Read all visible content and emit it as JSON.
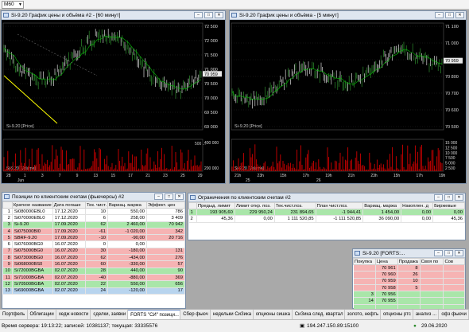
{
  "toolbar": {
    "timeframe": "M60"
  },
  "chart_windows": [
    {
      "title": "Si-9.20 График цены и объёма #2 - [60 минут]",
      "price_ticks": [
        "72 500",
        "72 000",
        "71 500",
        "71 000",
        "70 500",
        "70 000",
        "69 500",
        "69 000"
      ],
      "price_label": "Si-9.20 [Price]",
      "last_price": "70 959",
      "volume_label": "Si-9.20 [Volume]",
      "volume_ticks": [
        "400 000",
        "200 000"
      ],
      "volume_tag": "500 ...",
      "dates": [
        "28",
        "1",
        "3",
        "7",
        "9",
        "13",
        "15",
        "17",
        "21",
        "23",
        "25",
        "29"
      ],
      "month_labels": [
        "Jun"
      ]
    },
    {
      "title": "Si-9.20 График цены и объёма - [5 минут]",
      "price_ticks": [
        "71 100",
        "71 000",
        "70 900",
        "70 800",
        "70 700",
        "70 600",
        "70 500"
      ],
      "price_label": "Si-9.20 [Price]",
      "last_price": "70 959",
      "volume_label": "Si-9.20 [Volume]",
      "volume_ticks": [
        "15 000",
        "12 500",
        "10 000",
        "7 500",
        "5 000",
        "2 500"
      ],
      "dates": [
        "21h",
        "23h",
        "15h",
        "17h",
        "19h",
        "21h",
        "23h",
        "15h",
        "17h",
        "19h"
      ],
      "month_labels": [
        "25",
        "26"
      ]
    }
  ],
  "positions": {
    "title": "Позиции по клиентским счетам (фьючерсы) #2",
    "columns": [
      "",
      "Краткое название",
      "Дата погаше",
      "Тек. чист.",
      "Вариац. маржа",
      "Эффект. цен"
    ],
    "rows": [
      {
        "n": "1",
        "name": "Si080000EBL0",
        "date": "17.12.2020",
        "qty": "10",
        "var": "550,00",
        "eff": "786",
        "style": "white"
      },
      {
        "n": "2",
        "name": "Si070000EBL0",
        "date": "17.12.2020",
        "qty": "6",
        "var": "258,00",
        "eff": "3 409",
        "style": "white"
      },
      {
        "n": "3",
        "name": "Si-9.20",
        "date": "17.09.2020",
        "qty": "62",
        "var": "2 460,00",
        "eff": "70 942",
        "style": "green"
      },
      {
        "n": "4",
        "name": "Si075000BI0",
        "date": "17.09.2020",
        "qty": "-61",
        "var": "-1 020,00",
        "eff": "342",
        "style": "red"
      },
      {
        "n": "5",
        "name": "SBRF-9.20",
        "date": "17.09.2020",
        "qty": "-10",
        "var": "-90,00",
        "eff": "20 716",
        "style": "red"
      },
      {
        "n": "6",
        "name": "Si076000BG0",
        "date": "16.07.2020",
        "qty": "0",
        "var": "0,00",
        "eff": "",
        "style": "white"
      },
      {
        "n": "7",
        "name": "Si075000BG0",
        "date": "16.07.2020",
        "qty": "30",
        "var": "-180,00",
        "eff": "131",
        "style": "red"
      },
      {
        "n": "8",
        "name": "Si073000BG0",
        "date": "16.07.2020",
        "qty": "62",
        "var": "-434,00",
        "eff": "276",
        "style": "red"
      },
      {
        "n": "9",
        "name": "Si068000BS0",
        "date": "16.07.2020",
        "qty": "60",
        "var": "-330,00",
        "eff": "57",
        "style": "red"
      },
      {
        "n": "10",
        "name": "Si72000BGBA",
        "date": "02.07.2020",
        "qty": "28",
        "var": "440,00",
        "eff": "90",
        "style": "green"
      },
      {
        "n": "11",
        "name": "Si71000BGBA",
        "date": "02.07.2020",
        "qty": "-40",
        "var": "-880,00",
        "eff": "369",
        "style": "red"
      },
      {
        "n": "12",
        "name": "Si70500BGBA",
        "date": "02.07.2020",
        "qty": "22",
        "var": "550,00",
        "eff": "656",
        "style": "green"
      },
      {
        "n": "13",
        "name": "Si69000BGBA",
        "date": "02.07.2020",
        "qty": "24",
        "var": "-120,00",
        "eff": "17",
        "style": "sel"
      }
    ]
  },
  "limits": {
    "title": "Ограничения по клиентским счетам #2",
    "columns": [
      "",
      "Предыд. лимит",
      "Лимит откр. поз.",
      "Тек.чист.поз.",
      "План чист.поз.",
      "Вариац. маржа",
      "Накоплен. д",
      "Биржевые"
    ],
    "rows": [
      {
        "n": "1",
        "prev": "193 905,60",
        "lim": "229 950,24",
        "cur": "231 894,65",
        "plan": "-1 944,41",
        "var": "1 454,00",
        "acc": "0,00",
        "ex": "0,00",
        "style": "green"
      },
      {
        "n": "2",
        "prev": "45,36",
        "lim": "0,00",
        "cur": "1 111 520,85",
        "plan": "-1 111 520,85",
        "var": "36 090,00",
        "acc": "0,00",
        "ex": "45,36",
        "style": "white"
      }
    ]
  },
  "quotes": {
    "title": "Si-9.20 [FORTS:...",
    "columns": [
      "Покупка",
      "Цена",
      "Продажа",
      "Своя по",
      "Сов"
    ],
    "rows": [
      {
        "buy": "",
        "price": "70 961",
        "sell": "8",
        "style": "red"
      },
      {
        "buy": "",
        "price": "70 960",
        "sell": "26",
        "style": "red"
      },
      {
        "buy": "",
        "price": "70 959",
        "sell": "10",
        "style": "red"
      },
      {
        "buy": "",
        "price": "70 958",
        "sell": "5",
        "style": "red"
      },
      {
        "buy": "3",
        "price": "70 956",
        "sell": "",
        "style": "green"
      },
      {
        "buy": "14",
        "price": "70 955",
        "sell": "",
        "style": "green"
      },
      {
        "buy": "",
        "price": "",
        "sell": "",
        "style": "green"
      }
    ]
  },
  "tabs": [
    "Портфель",
    "Облигации",
    "хедж новости",
    "сделки, заявки",
    "FORTS \"СИ\" позици...",
    "Сбер фьюч",
    "недельки СиЗика",
    "опционы сишка",
    "СиЗика след. квартал",
    "золото, нефть",
    "опционы ртс",
    "анализ ...",
    "офз фьючи"
  ],
  "active_tab": 4,
  "status": {
    "server_time": "Время сервера: 19:13:22; записей: 10381137; текущая: 33335576",
    "ip": "194.247.150.89:15100",
    "date": "29.06.2020"
  },
  "colors": {
    "chart_bg": "#000000",
    "price_line": "#d0d0d0",
    "volume_bar": "#d00000",
    "trend_line": "#ffff00",
    "ma_line": "#00c000"
  }
}
